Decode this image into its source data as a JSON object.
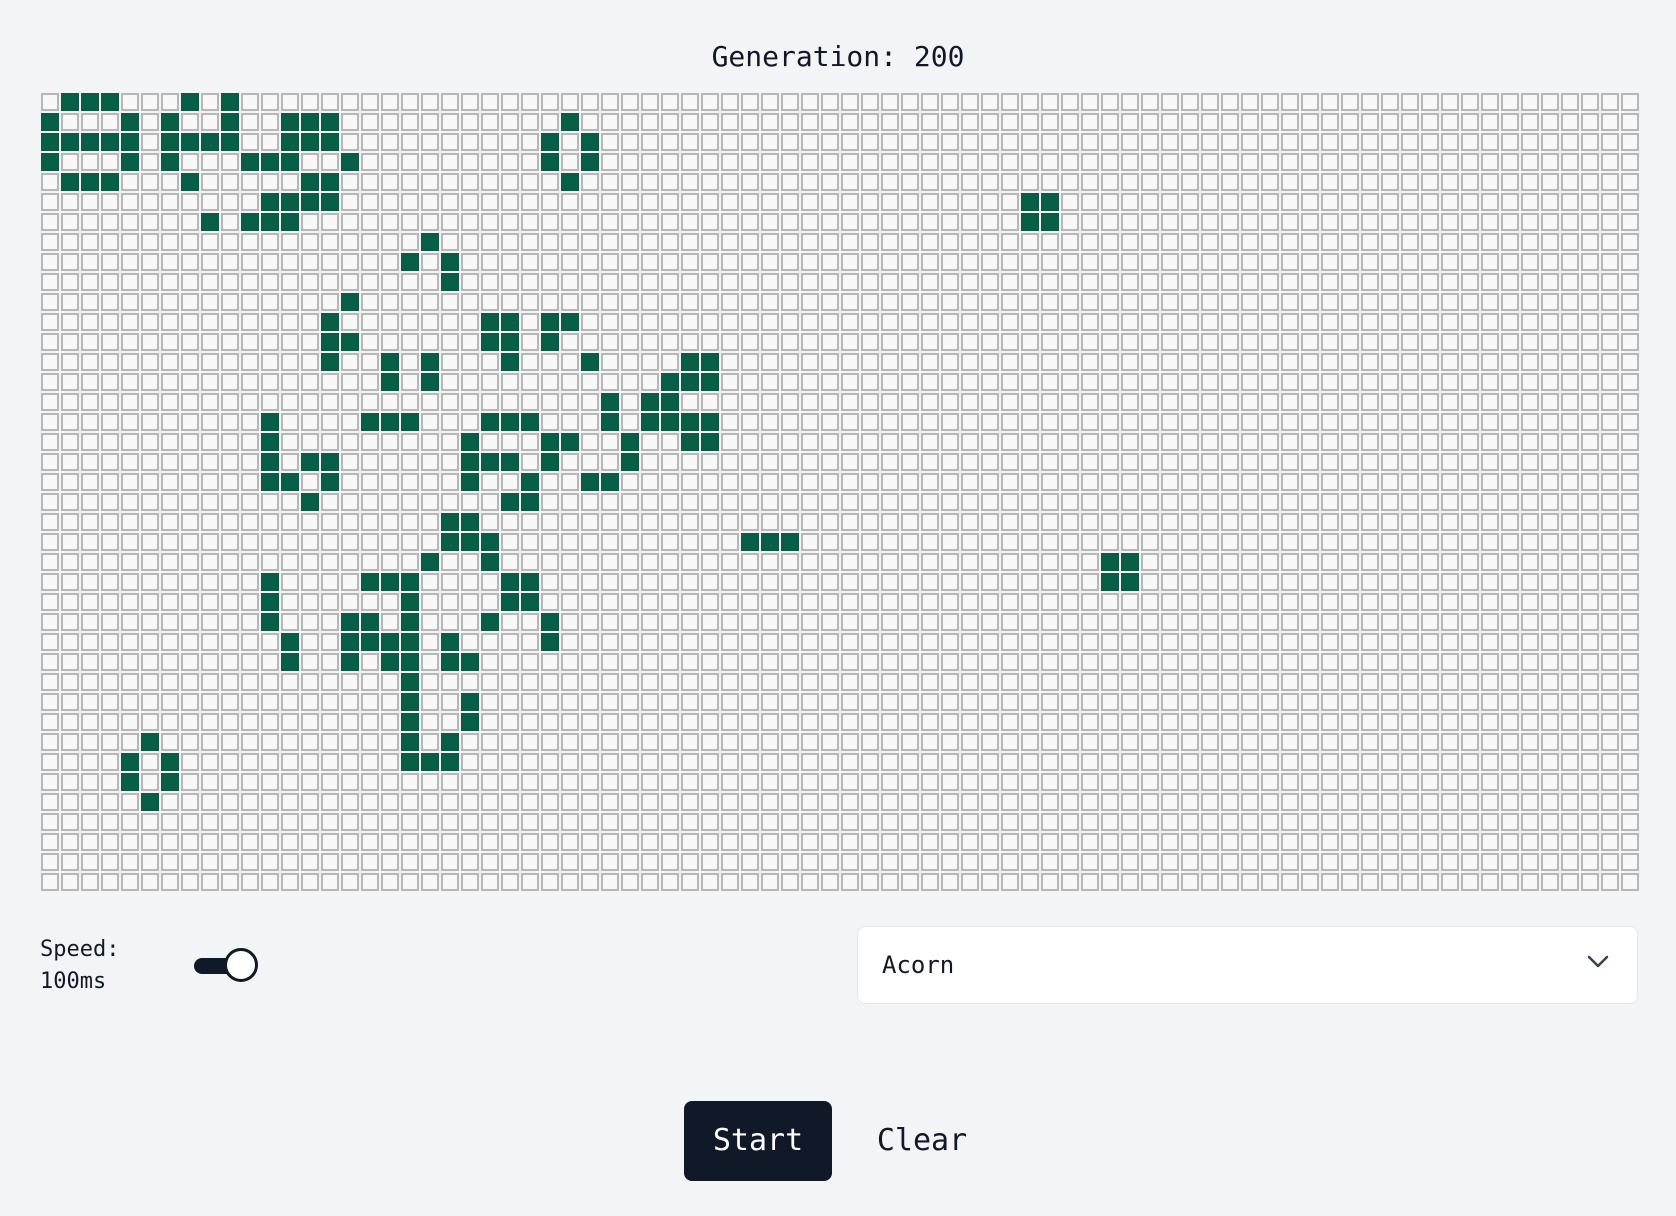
{
  "header": {
    "generation_text": "Generation: 200"
  },
  "grid": {
    "cols": 80,
    "rows": 40,
    "alive_color": "#065f46",
    "dead_color": "#f7f7f7",
    "alive_cells": [
      [
        0,
        1
      ],
      [
        0,
        2
      ],
      [
        0,
        3
      ],
      [
        0,
        7
      ],
      [
        0,
        9
      ],
      [
        1,
        0
      ],
      [
        1,
        4
      ],
      [
        1,
        6
      ],
      [
        1,
        9
      ],
      [
        1,
        12
      ],
      [
        1,
        13
      ],
      [
        1,
        14
      ],
      [
        1,
        26
      ],
      [
        2,
        0
      ],
      [
        2,
        1
      ],
      [
        2,
        2
      ],
      [
        2,
        3
      ],
      [
        2,
        4
      ],
      [
        2,
        6
      ],
      [
        2,
        7
      ],
      [
        2,
        8
      ],
      [
        2,
        9
      ],
      [
        2,
        12
      ],
      [
        2,
        13
      ],
      [
        2,
        14
      ],
      [
        2,
        25
      ],
      [
        2,
        27
      ],
      [
        3,
        0
      ],
      [
        3,
        4
      ],
      [
        3,
        6
      ],
      [
        3,
        10
      ],
      [
        3,
        11
      ],
      [
        3,
        12
      ],
      [
        3,
        15
      ],
      [
        3,
        25
      ],
      [
        3,
        27
      ],
      [
        4,
        1
      ],
      [
        4,
        2
      ],
      [
        4,
        3
      ],
      [
        4,
        7
      ],
      [
        4,
        13
      ],
      [
        4,
        14
      ],
      [
        4,
        26
      ],
      [
        5,
        11
      ],
      [
        5,
        12
      ],
      [
        5,
        13
      ],
      [
        5,
        14
      ],
      [
        5,
        49
      ],
      [
        5,
        50
      ],
      [
        6,
        8
      ],
      [
        6,
        10
      ],
      [
        6,
        11
      ],
      [
        6,
        12
      ],
      [
        6,
        49
      ],
      [
        6,
        50
      ],
      [
        7,
        19
      ],
      [
        8,
        18
      ],
      [
        8,
        20
      ],
      [
        9,
        20
      ],
      [
        10,
        15
      ],
      [
        11,
        14
      ],
      [
        11,
        22
      ],
      [
        11,
        23
      ],
      [
        11,
        25
      ],
      [
        11,
        26
      ],
      [
        12,
        14
      ],
      [
        12,
        15
      ],
      [
        12,
        22
      ],
      [
        12,
        23
      ],
      [
        12,
        25
      ],
      [
        13,
        14
      ],
      [
        13,
        17
      ],
      [
        13,
        19
      ],
      [
        13,
        23
      ],
      [
        13,
        27
      ],
      [
        13,
        32
      ],
      [
        13,
        33
      ],
      [
        14,
        17
      ],
      [
        14,
        19
      ],
      [
        14,
        31
      ],
      [
        14,
        32
      ],
      [
        14,
        33
      ],
      [
        15,
        28
      ],
      [
        15,
        30
      ],
      [
        15,
        31
      ],
      [
        16,
        11
      ],
      [
        16,
        16
      ],
      [
        16,
        17
      ],
      [
        16,
        18
      ],
      [
        16,
        22
      ],
      [
        16,
        23
      ],
      [
        16,
        24
      ],
      [
        16,
        28
      ],
      [
        16,
        30
      ],
      [
        16,
        31
      ],
      [
        16,
        32
      ],
      [
        16,
        33
      ],
      [
        17,
        11
      ],
      [
        17,
        21
      ],
      [
        17,
        25
      ],
      [
        17,
        26
      ],
      [
        17,
        29
      ],
      [
        17,
        32
      ],
      [
        17,
        33
      ],
      [
        18,
        11
      ],
      [
        18,
        13
      ],
      [
        18,
        14
      ],
      [
        18,
        21
      ],
      [
        18,
        22
      ],
      [
        18,
        23
      ],
      [
        18,
        25
      ],
      [
        18,
        29
      ],
      [
        19,
        11
      ],
      [
        19,
        12
      ],
      [
        19,
        14
      ],
      [
        19,
        21
      ],
      [
        19,
        24
      ],
      [
        19,
        27
      ],
      [
        19,
        28
      ],
      [
        20,
        13
      ],
      [
        20,
        23
      ],
      [
        20,
        24
      ],
      [
        21,
        20
      ],
      [
        21,
        21
      ],
      [
        22,
        20
      ],
      [
        22,
        21
      ],
      [
        22,
        22
      ],
      [
        22,
        35
      ],
      [
        22,
        36
      ],
      [
        22,
        37
      ],
      [
        23,
        19
      ],
      [
        23,
        22
      ],
      [
        23,
        53
      ],
      [
        23,
        54
      ],
      [
        24,
        11
      ],
      [
        24,
        16
      ],
      [
        24,
        17
      ],
      [
        24,
        18
      ],
      [
        24,
        23
      ],
      [
        24,
        24
      ],
      [
        24,
        53
      ],
      [
        24,
        54
      ],
      [
        25,
        11
      ],
      [
        25,
        18
      ],
      [
        25,
        23
      ],
      [
        25,
        24
      ],
      [
        26,
        11
      ],
      [
        26,
        15
      ],
      [
        26,
        16
      ],
      [
        26,
        18
      ],
      [
        26,
        22
      ],
      [
        26,
        25
      ],
      [
        27,
        12
      ],
      [
        27,
        15
      ],
      [
        27,
        16
      ],
      [
        27,
        17
      ],
      [
        27,
        18
      ],
      [
        27,
        20
      ],
      [
        27,
        25
      ],
      [
        28,
        12
      ],
      [
        28,
        15
      ],
      [
        28,
        17
      ],
      [
        28,
        18
      ],
      [
        28,
        20
      ],
      [
        28,
        21
      ],
      [
        29,
        18
      ],
      [
        30,
        18
      ],
      [
        30,
        21
      ],
      [
        31,
        18
      ],
      [
        31,
        21
      ],
      [
        32,
        5
      ],
      [
        32,
        18
      ],
      [
        32,
        20
      ],
      [
        33,
        4
      ],
      [
        33,
        6
      ],
      [
        33,
        18
      ],
      [
        33,
        19
      ],
      [
        33,
        20
      ],
      [
        34,
        4
      ],
      [
        34,
        6
      ],
      [
        35,
        5
      ]
    ]
  },
  "controls": {
    "speed_label": "Speed:",
    "speed_value": "100ms",
    "speed_fraction": 1.0,
    "pattern_selected": "Acorn",
    "start_label": "Start",
    "clear_label": "Clear"
  },
  "icons": {
    "select_arrow": "chevron-down-icon"
  }
}
